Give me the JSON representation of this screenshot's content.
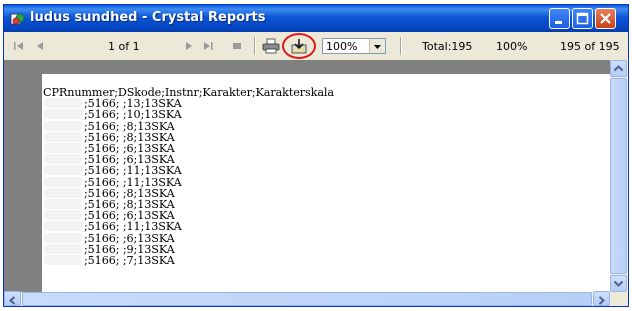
{
  "window": {
    "title": "ludus sundhed - Crystal Reports",
    "icon": "crystal-reports-app-icon"
  },
  "toolbar": {
    "page_indicator": "1 of 1",
    "zoom_value": "100%",
    "total_label": "Total:195",
    "percent_label": "100%",
    "records_label": "195 of 195",
    "buttons": [
      "first-page-icon",
      "previous-page-icon",
      "next-page-icon",
      "last-page-icon",
      "stop-icon",
      "print-icon",
      "export-icon"
    ]
  },
  "report": {
    "lines": [
      "CPRnummer;DSkode;Instnr;Karakter;Karakterskala",
      ";5166;        ;13;13SKA",
      ";5166;        ;10;13SKA",
      ";5166;        ;8;13SKA",
      ";5166;        ;8;13SKA",
      ";5166;        ;6;13SKA",
      ";5166;        ;6;13SKA",
      ";5166;        ;11;13SKA",
      ";5166;        ;11;13SKA",
      ";5166;        ;8;13SKA",
      ";5166;        ;8;13SKA",
      ";5166;        ;6;13SKA",
      ";5166;        ;11;13SKA",
      ";5166;        ;6;13SKA",
      ";5166;        ;9;13SKA",
      ";5166;        ;7;13SKA"
    ]
  }
}
